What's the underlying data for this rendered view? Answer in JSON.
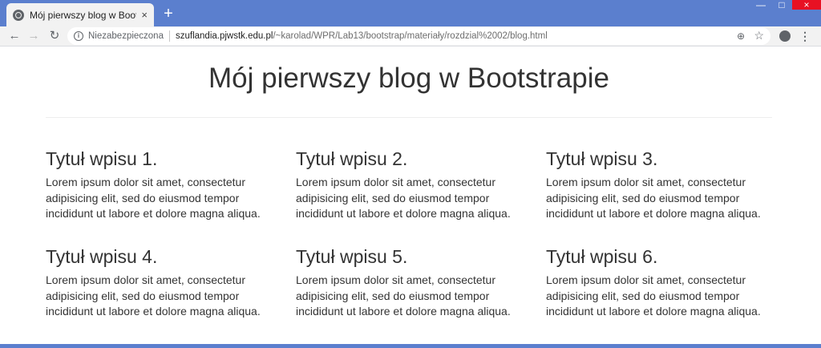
{
  "tab": {
    "title": "Mój pierwszy blog w Bootstrapie",
    "close": "×",
    "new_tab": "+"
  },
  "window": {
    "minimize": "—",
    "maximize": "□",
    "close": "×"
  },
  "nav": {
    "back": "←",
    "forward": "→",
    "reload": "↻"
  },
  "omnibox": {
    "info": "i",
    "security": "Niezabezpieczona",
    "host": "szuflandia.pjwstk.edu.pl",
    "path": "/~karolad/WPR/Lab13/bootstrap/materiały/rozdzial%2002/blog.html",
    "zoom": "⊕",
    "star": "☆"
  },
  "toolbar": {
    "menu": "⋮"
  },
  "page": {
    "title": "Mój pierwszy blog w Bootstrapie",
    "posts": [
      {
        "title": "Tytuł wpisu 1.",
        "body": "Lorem ipsum dolor sit amet, consectetur adipisicing elit, sed do eiusmod tempor incididunt ut labore et dolore magna aliqua."
      },
      {
        "title": "Tytuł wpisu 2.",
        "body": "Lorem ipsum dolor sit amet, consectetur adipisicing elit, sed do eiusmod tempor incididunt ut labore et dolore magna aliqua."
      },
      {
        "title": "Tytuł wpisu 3.",
        "body": "Lorem ipsum dolor sit amet, consectetur adipisicing elit, sed do eiusmod tempor incididunt ut labore et dolore magna aliqua."
      },
      {
        "title": "Tytuł wpisu 4.",
        "body": "Lorem ipsum dolor sit amet, consectetur adipisicing elit, sed do eiusmod tempor incididunt ut labore et dolore magna aliqua."
      },
      {
        "title": "Tytuł wpisu 5.",
        "body": "Lorem ipsum dolor sit amet, consectetur adipisicing elit, sed do eiusmod tempor incididunt ut labore et dolore magna aliqua."
      },
      {
        "title": "Tytuł wpisu 6.",
        "body": "Lorem ipsum dolor sit amet, consectetur adipisicing elit, sed do eiusmod tempor incididunt ut labore et dolore magna aliqua."
      }
    ]
  },
  "colors": {
    "frame": "#5b7fce",
    "close_button": "#e81123",
    "text": "#333333"
  }
}
